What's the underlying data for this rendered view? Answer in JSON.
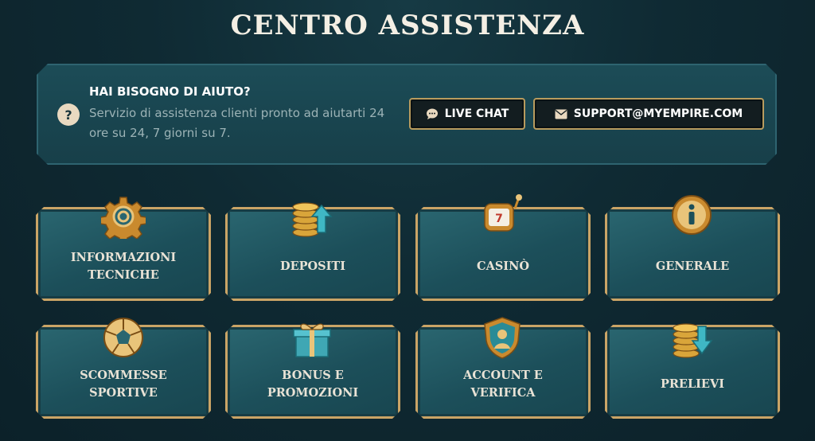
{
  "page": {
    "title": "CENTRO ASSISTENZA"
  },
  "help": {
    "title": "HAI BISOGNO DI AIUTO?",
    "text": "Servizio di assistenza clienti pronto ad aiutarti 24 ore su 24, 7 giorni su 7.",
    "icon": "question-icon"
  },
  "buttons": {
    "live_chat": "LIVE CHAT",
    "email": "SUPPORT@MYEMPIRE.COM",
    "chat_icon": "chat-bubble-icon",
    "email_icon": "envelope-icon"
  },
  "categories": [
    {
      "label": "INFORMAZIONI\nTECNICHE",
      "icon": "gear-icon"
    },
    {
      "label": "DEPOSITI",
      "icon": "coins-up-arrow-icon"
    },
    {
      "label": "CASINÒ",
      "icon": "slot-machine-icon"
    },
    {
      "label": "GENERALE",
      "icon": "info-icon"
    },
    {
      "label": "SCOMMESSE\nSPORTIVE",
      "icon": "soccer-ball-icon"
    },
    {
      "label": "BONUS E\nPROMOZIONI",
      "icon": "gift-icon"
    },
    {
      "label": "ACCOUNT E\nVERIFICA",
      "icon": "shield-user-icon"
    },
    {
      "label": "PRELIEVI",
      "icon": "coins-down-arrow-icon"
    }
  ],
  "colors": {
    "accent_gold": "#caa466",
    "panel": "#1c4c57",
    "background": "#0f2a33"
  }
}
